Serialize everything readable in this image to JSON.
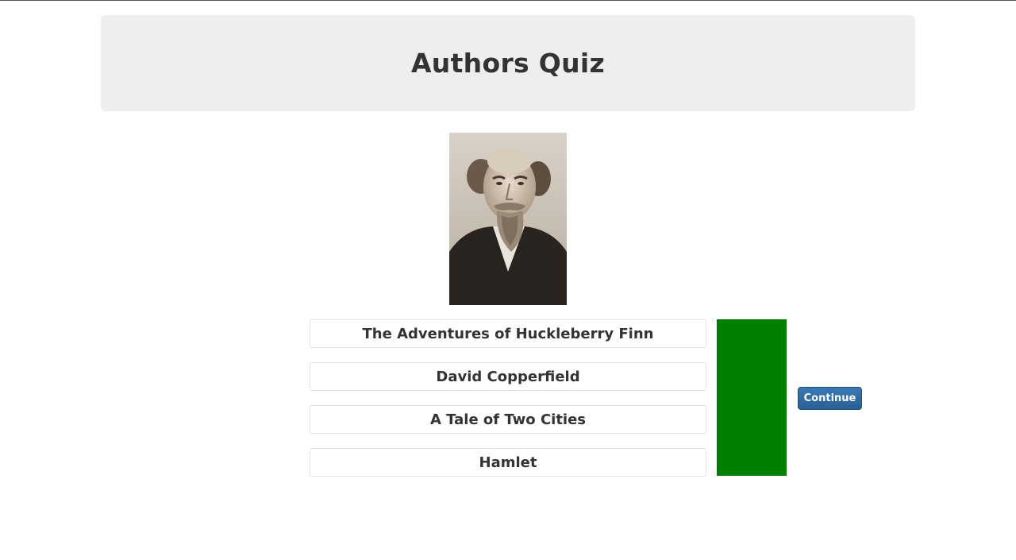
{
  "header": {
    "title": "Authors Quiz"
  },
  "author_image": {
    "icon": "author-portrait-icon"
  },
  "answers": [
    {
      "title": "The Adventures of Huckleberry Finn"
    },
    {
      "title": "David Copperfield"
    },
    {
      "title": "A Tale of Two Cities"
    },
    {
      "title": "Hamlet"
    }
  ],
  "result": {
    "color": "#008000"
  },
  "continue_button": {
    "label": "Continue"
  }
}
